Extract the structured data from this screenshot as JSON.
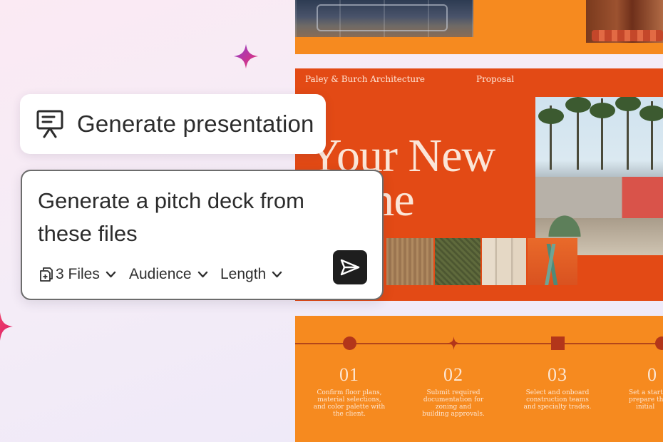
{
  "chip": {
    "label": "Generate presentation",
    "icon": "presentation-icon"
  },
  "prompt": {
    "text_line1": "Generate a pitch deck from",
    "text_line2": "these files",
    "options": {
      "files": {
        "label": "3 Files",
        "icon": "files-icon"
      },
      "audience": {
        "label": "Audience"
      },
      "length": {
        "label": "Length"
      }
    },
    "send_icon": "send-icon"
  },
  "slide_main": {
    "brand": "Paley & Burch Architecture",
    "section": "Proposal",
    "title_line1": "Your New",
    "title_line2": "me"
  },
  "timeline": {
    "steps": [
      {
        "number": "01",
        "marker": "circle",
        "desc": [
          "Confirm floor plans,",
          "material selections,",
          "and color palette with",
          "the client."
        ]
      },
      {
        "number": "02",
        "marker": "star",
        "desc": [
          "Submit required",
          "documentation for",
          "zoning and",
          "building approvals."
        ]
      },
      {
        "number": "03",
        "marker": "square",
        "desc": [
          "Select and onboard",
          "construction teams",
          "and specialty trades."
        ]
      },
      {
        "number": "0",
        "marker": "circle",
        "desc": [
          "Set a start",
          "prepare th",
          "initial"
        ]
      }
    ]
  },
  "colors": {
    "accent_orange": "#f68a1f",
    "slide_red": "#e34a15",
    "send_button": "#1e1e1e"
  }
}
